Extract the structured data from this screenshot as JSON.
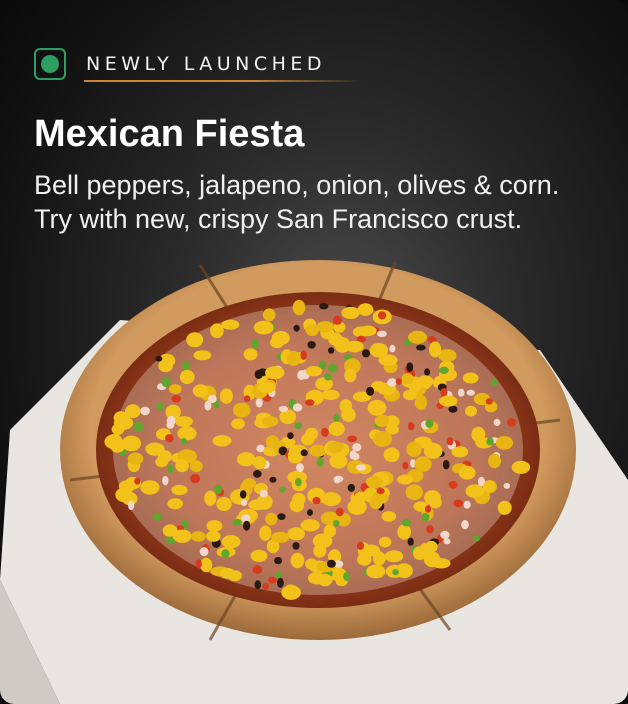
{
  "badge": {
    "label": "NEWLY LAUNCHED",
    "veg_color": "#2e9e63"
  },
  "product": {
    "name": "Mexican Fiesta",
    "description_line1": "Bell peppers, jalapeno, onion, olives & corn.",
    "description_line2": "Try with new, crispy San Francisco crust."
  },
  "image": {
    "icon": "pizza-image"
  }
}
